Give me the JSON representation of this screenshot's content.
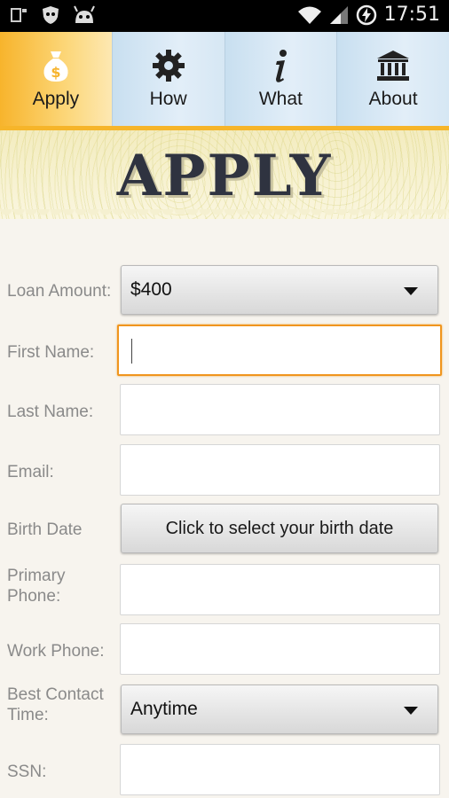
{
  "status_bar": {
    "time": "17:51"
  },
  "tabs": [
    {
      "label": "Apply",
      "icon": "money-bag-icon",
      "active": true
    },
    {
      "label": "How",
      "icon": "gear-icon",
      "active": false
    },
    {
      "label": "What",
      "icon": "info-icon",
      "active": false
    },
    {
      "label": "About",
      "icon": "bank-icon",
      "active": false
    }
  ],
  "banner": {
    "title": "APPLY"
  },
  "form": {
    "loan_amount": {
      "label": "Loan Amount:",
      "value": "$400"
    },
    "first_name": {
      "label": "First Name:",
      "value": ""
    },
    "last_name": {
      "label": "Last Name:",
      "value": ""
    },
    "email": {
      "label": "Email:",
      "value": ""
    },
    "birth_date": {
      "label": "Birth Date",
      "button": "Click to select your birth date"
    },
    "primary_phone": {
      "label": "Primary Phone:",
      "value": ""
    },
    "work_phone": {
      "label": "Work Phone:",
      "value": ""
    },
    "best_contact_time": {
      "label": "Best Contact Time:",
      "value": "Anytime"
    },
    "ssn": {
      "label": "SSN:",
      "value": ""
    }
  },
  "colors": {
    "accent": "#f6b52a",
    "focus": "#f0951e",
    "tab_bg": "#d6e7f4"
  }
}
